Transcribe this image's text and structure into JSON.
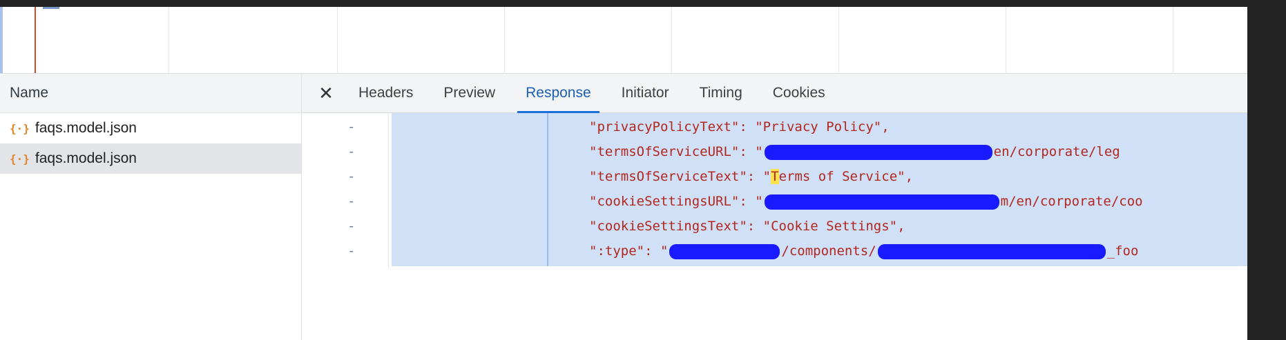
{
  "name_column": {
    "header": "Name",
    "requests": [
      {
        "label": "faqs.model.json",
        "icon": "json-file-icon",
        "selected": false
      },
      {
        "label": "faqs.model.json",
        "icon": "json-file-icon",
        "selected": true
      }
    ]
  },
  "details": {
    "close_glyph": "✕",
    "tabs": [
      {
        "label": "Headers",
        "active": false
      },
      {
        "label": "Preview",
        "active": false
      },
      {
        "label": "Response",
        "active": true
      },
      {
        "label": "Initiator",
        "active": false
      },
      {
        "label": "Timing",
        "active": false
      },
      {
        "label": "Cookies",
        "active": false
      }
    ]
  },
  "response": {
    "gutter_marker": "-",
    "lines": [
      {
        "pre": "\"privacyPolicyText\": \"Privacy Policy\",",
        "redacted_width": 0,
        "post": ""
      },
      {
        "pre": "\"termsOfServiceURL\": \"",
        "redacted_width": 330,
        "post": "en/corporate/leg"
      },
      {
        "pre": "\"termsOfServiceText\": \"",
        "highlight": "T",
        "post_plain": "erms of Service\","
      },
      {
        "pre": "\"cookieSettingsURL\": \"",
        "redacted_width": 340,
        "post": "m/en/corporate/coo"
      },
      {
        "pre": "\"cookieSettingsText\": \"Cookie Settings\",",
        "redacted_width": 0,
        "post": ""
      },
      {
        "pre": "\":type\": \"",
        "redacted_width": 160,
        "mid": "/components/",
        "redacted_width2": 330,
        "post": "_foo"
      }
    ]
  },
  "colors": {
    "accent": "#1a6ed8",
    "json_key_string": "#b3261e",
    "selection": "#cfe0f7",
    "redaction": "#1a1aff",
    "json_icon": "#e0862b"
  }
}
